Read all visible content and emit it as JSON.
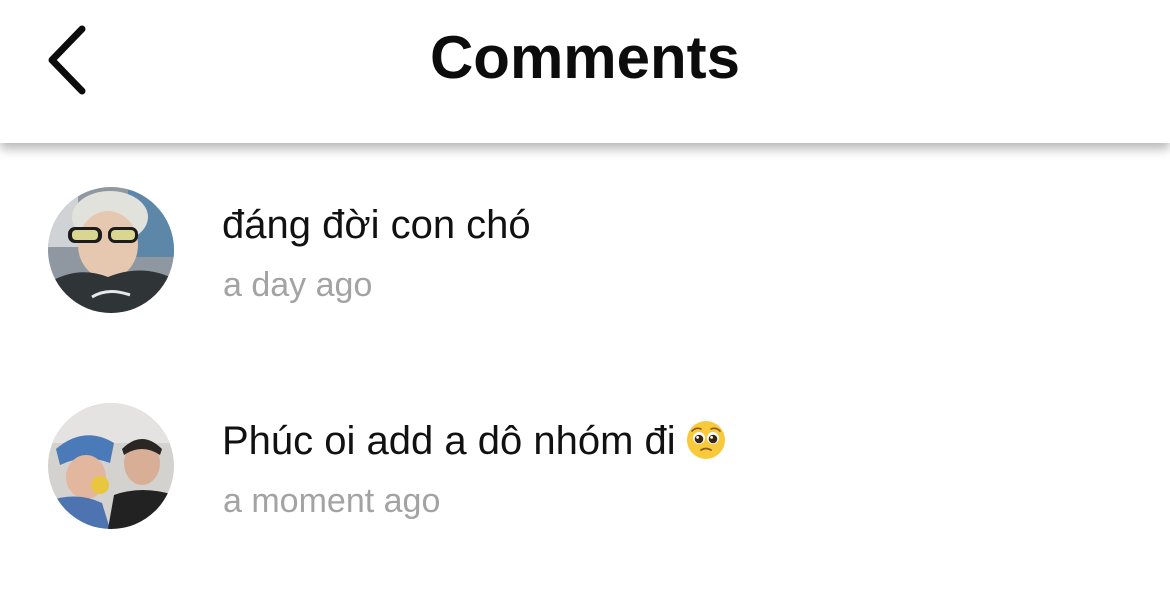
{
  "header": {
    "title": "Comments",
    "back_icon": "chevron-left-icon"
  },
  "comments": [
    {
      "text": "đáng đời con chó",
      "time": "a day ago"
    },
    {
      "text": "Phúc oi add a dô nhóm đi",
      "emoji": "pleading-face-icon",
      "time": "a moment ago"
    }
  ],
  "colors": {
    "title": "#0c0c0c",
    "comment_text": "#111111",
    "timestamp": "#a3a3a3",
    "background": "#ffffff"
  }
}
